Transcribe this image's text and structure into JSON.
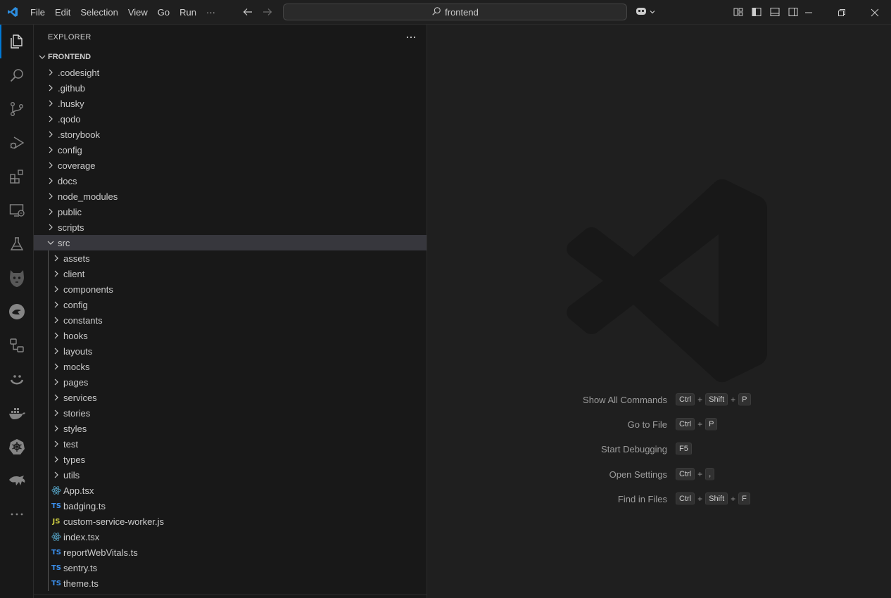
{
  "titlebar": {
    "menu": [
      "File",
      "Edit",
      "Selection",
      "View",
      "Go",
      "Run",
      "···"
    ],
    "search_text": "frontend"
  },
  "activitybar": {
    "items": [
      {
        "name": "explorer-icon",
        "active": true
      },
      {
        "name": "search-icon"
      },
      {
        "name": "source-control-icon"
      },
      {
        "name": "run-debug-icon"
      },
      {
        "name": "extensions-icon"
      },
      {
        "name": "remote-explorer-icon"
      },
      {
        "name": "testing-icon"
      },
      {
        "name": "snyk-icon"
      },
      {
        "name": "gitlens-icon"
      },
      {
        "name": "diagram-icon"
      },
      {
        "name": "smiley-icon"
      },
      {
        "name": "docker-icon"
      },
      {
        "name": "kubernetes-icon"
      },
      {
        "name": "dragon-icon"
      },
      {
        "name": "more-icon"
      }
    ]
  },
  "sidebar": {
    "title": "EXPLORER",
    "more": "···",
    "section_title": "FRONTEND",
    "root_folders": [
      ".codesight",
      ".github",
      ".husky",
      ".qodo",
      ".storybook",
      "config",
      "coverage",
      "docs",
      "node_modules",
      "public",
      "scripts"
    ],
    "src_label": "src",
    "src_folders": [
      "assets",
      "client",
      "components",
      "config",
      "constants",
      "hooks",
      "layouts",
      "mocks",
      "pages",
      "services",
      "stories",
      "styles",
      "test",
      "types",
      "utils"
    ],
    "src_files": [
      {
        "name": "App.tsx",
        "icon": "react",
        "badge": ""
      },
      {
        "name": "badging.ts",
        "icon": "ts",
        "badge": "TS"
      },
      {
        "name": "custom-service-worker.js",
        "icon": "js",
        "badge": "JS"
      },
      {
        "name": "index.tsx",
        "icon": "react",
        "badge": ""
      },
      {
        "name": "reportWebVitals.ts",
        "icon": "ts",
        "badge": "TS"
      },
      {
        "name": "sentry.ts",
        "icon": "ts",
        "badge": "TS"
      },
      {
        "name": "theme.ts",
        "icon": "ts",
        "badge": "TS"
      }
    ]
  },
  "editor": {
    "shortcuts": [
      {
        "label": "Show All Commands",
        "keys": [
          "Ctrl",
          "Shift",
          "P"
        ]
      },
      {
        "label": "Go to File",
        "keys": [
          "Ctrl",
          "P"
        ]
      },
      {
        "label": "Start Debugging",
        "keys": [
          "F5"
        ]
      },
      {
        "label": "Open Settings",
        "keys": [
          "Ctrl",
          ","
        ]
      },
      {
        "label": "Find in Files",
        "keys": [
          "Ctrl",
          "Shift",
          "F"
        ]
      }
    ]
  },
  "colors": {
    "accent": "#0078d4",
    "ts": "#3b8eea",
    "js": "#cbcb41",
    "react": "#519aba"
  }
}
